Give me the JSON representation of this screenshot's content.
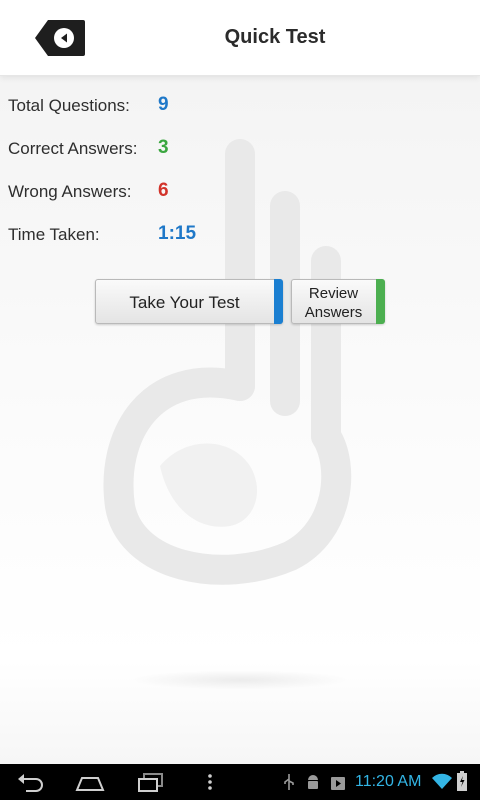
{
  "header": {
    "title": "Quick Test",
    "back_icon": "back-arrow-icon"
  },
  "stats": [
    {
      "label": "Total Questions:",
      "value": "9",
      "color": "#1f78c8"
    },
    {
      "label": "Correct Answers:",
      "value": "3",
      "color": "#3aa63f"
    },
    {
      "label": "Wrong Answers:",
      "value": "6",
      "color": "#d2332a"
    },
    {
      "label": "Time Taken:",
      "value": "1:15",
      "color": "#1f78c8"
    }
  ],
  "buttons": {
    "take_test": {
      "label": "Take Your Test",
      "accent": "#1b7fd1"
    },
    "review": {
      "label_line1": "Review",
      "label_line2": "Answers",
      "accent": "#4caf50"
    }
  },
  "system_bar": {
    "time": "11:20 AM",
    "time_color": "#33b5e5",
    "nav_icons": [
      "back-nav-icon",
      "home-nav-icon",
      "recent-apps-icon",
      "menu-dots-icon"
    ],
    "status_icons": [
      "usb-icon",
      "android-debug-icon",
      "play-store-icon",
      "wifi-icon",
      "battery-icon"
    ]
  }
}
